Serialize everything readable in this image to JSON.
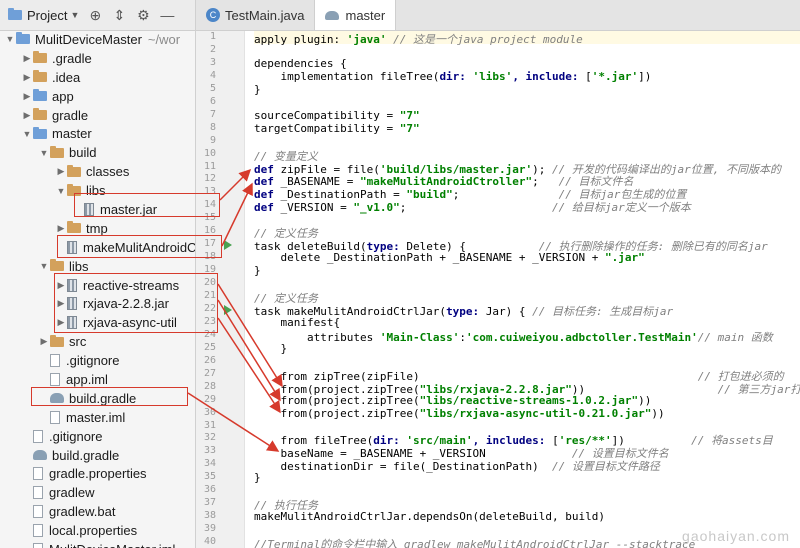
{
  "project_panel": {
    "selector_label": "Project",
    "tree": [
      {
        "indent": 0,
        "arrow": "down",
        "icon": "folder-blue",
        "label": "MulitDeviceMaster",
        "suffix": "~/wor"
      },
      {
        "indent": 1,
        "arrow": "right",
        "icon": "folder",
        "label": ".gradle"
      },
      {
        "indent": 1,
        "arrow": "right",
        "icon": "folder",
        "label": ".idea"
      },
      {
        "indent": 1,
        "arrow": "right",
        "icon": "folder-blue",
        "label": "app"
      },
      {
        "indent": 1,
        "arrow": "right",
        "icon": "folder",
        "label": "gradle"
      },
      {
        "indent": 1,
        "arrow": "down",
        "icon": "folder-blue",
        "label": "master"
      },
      {
        "indent": 2,
        "arrow": "down",
        "icon": "folder",
        "label": "build"
      },
      {
        "indent": 3,
        "arrow": "right",
        "icon": "folder",
        "label": "classes"
      },
      {
        "indent": 3,
        "arrow": "down",
        "icon": "folder",
        "label": "libs"
      },
      {
        "indent": 4,
        "arrow": "",
        "icon": "jar",
        "label": "master.jar"
      },
      {
        "indent": 3,
        "arrow": "right",
        "icon": "folder",
        "label": "tmp"
      },
      {
        "indent": 3,
        "arrow": "",
        "icon": "jar",
        "label": "makeMulitAndroidCtrller"
      },
      {
        "indent": 2,
        "arrow": "down",
        "icon": "folder",
        "label": "libs"
      },
      {
        "indent": 3,
        "arrow": "right",
        "icon": "jar",
        "label": "reactive-streams"
      },
      {
        "indent": 3,
        "arrow": "right",
        "icon": "jar",
        "label": "rxjava-2.2.8.jar"
      },
      {
        "indent": 3,
        "arrow": "right",
        "icon": "jar",
        "label": "rxjava-async-util"
      },
      {
        "indent": 2,
        "arrow": "right",
        "icon": "folder",
        "label": "src"
      },
      {
        "indent": 2,
        "arrow": "",
        "icon": "file",
        "label": ".gitignore"
      },
      {
        "indent": 2,
        "arrow": "",
        "icon": "file",
        "label": "app.iml"
      },
      {
        "indent": 2,
        "arrow": "",
        "icon": "gradle",
        "label": "build.gradle"
      },
      {
        "indent": 2,
        "arrow": "",
        "icon": "file",
        "label": "master.iml"
      },
      {
        "indent": 1,
        "arrow": "",
        "icon": "file",
        "label": ".gitignore"
      },
      {
        "indent": 1,
        "arrow": "",
        "icon": "gradle",
        "label": "build.gradle"
      },
      {
        "indent": 1,
        "arrow": "",
        "icon": "file",
        "label": "gradle.properties"
      },
      {
        "indent": 1,
        "arrow": "",
        "icon": "file",
        "label": "gradlew"
      },
      {
        "indent": 1,
        "arrow": "",
        "icon": "file",
        "label": "gradlew.bat"
      },
      {
        "indent": 1,
        "arrow": "",
        "icon": "file",
        "label": "local.properties"
      },
      {
        "indent": 1,
        "arrow": "",
        "icon": "file",
        "label": "MulitDeviceMaster.iml"
      }
    ]
  },
  "tabs": [
    {
      "label": "TestMain.java",
      "icon": "java-class-icon",
      "active": false
    },
    {
      "label": "master",
      "icon": "gradle-icon",
      "active": true
    }
  ],
  "editor": {
    "run_marker_lines": [
      17,
      22
    ],
    "current_line": 1,
    "lines": [
      [
        [
          "plain",
          "apply plugin: "
        ],
        [
          "str",
          "'java'"
        ],
        [
          "cmt",
          " // 这是一个java project module"
        ]
      ],
      [],
      [
        [
          "plain",
          "dependencies {"
        ]
      ],
      [
        [
          "plain",
          "    implementation fileTree("
        ],
        [
          "kw",
          "dir: "
        ],
        [
          "str",
          "'libs'"
        ],
        [
          "kw",
          ", include: "
        ],
        [
          "plain",
          "["
        ],
        [
          "str",
          "'*.jar'"
        ],
        [
          "plain",
          "])"
        ]
      ],
      [
        [
          "plain",
          "}"
        ]
      ],
      [],
      [
        [
          "plain",
          "sourceCompatibility = "
        ],
        [
          "str",
          "\"7\""
        ]
      ],
      [
        [
          "plain",
          "targetCompatibility = "
        ],
        [
          "str",
          "\"7\""
        ]
      ],
      [],
      [
        [
          "cmt",
          "// 变量定义"
        ]
      ],
      [
        [
          "kw",
          "def "
        ],
        [
          "plain",
          "zipFile = file("
        ],
        [
          "str",
          "'build/libs/master.jar'"
        ],
        [
          "plain",
          ");"
        ],
        [
          "cmt",
          " // 开发的代码编译出的jar位置, 不同版本的"
        ]
      ],
      [
        [
          "kw",
          "def "
        ],
        [
          "plain",
          "_BASENAME = "
        ],
        [
          "str",
          "\"makeMulitAndroidCtroller\""
        ],
        [
          "plain",
          ";"
        ],
        [
          "cmt",
          "   // 目标文件名"
        ]
      ],
      [
        [
          "kw",
          "def "
        ],
        [
          "plain",
          "_DestinationPath = "
        ],
        [
          "str",
          "\"build\""
        ],
        [
          "plain",
          ";"
        ],
        [
          "cmt",
          "               // 目标jar包生成的位置"
        ]
      ],
      [
        [
          "kw",
          "def "
        ],
        [
          "plain",
          "_VERSION = "
        ],
        [
          "str",
          "\"_v1.0\""
        ],
        [
          "plain",
          ";"
        ],
        [
          "cmt",
          "                      // 给目标jar定义一个版本"
        ]
      ],
      [],
      [
        [
          "cmt",
          "// 定义任务"
        ]
      ],
      [
        [
          "plain",
          "task deleteBuild("
        ],
        [
          "kw",
          "type: "
        ],
        [
          "plain",
          "Delete) {"
        ],
        [
          "cmt",
          "           // 执行删除操作的任务: 删除已有的同名jar"
        ]
      ],
      [
        [
          "plain",
          "    delete _DestinationPath + _BASENAME + _VERSION + "
        ],
        [
          "str",
          "\".jar\""
        ]
      ],
      [
        [
          "plain",
          "}"
        ]
      ],
      [],
      [
        [
          "cmt",
          "// 定义任务"
        ]
      ],
      [
        [
          "plain",
          "task makeMulitAndroidCtrlJar("
        ],
        [
          "kw",
          "type: "
        ],
        [
          "plain",
          "Jar) {"
        ],
        [
          "cmt",
          " // 目标任务: 生成目标jar"
        ]
      ],
      [
        [
          "plain",
          "    manifest{"
        ]
      ],
      [
        [
          "plain",
          "        attributes "
        ],
        [
          "str",
          "'Main-Class'"
        ],
        [
          "plain",
          ":"
        ],
        [
          "str",
          "'com.cuiweiyou.adbctoller.TestMain'"
        ],
        [
          "cmt",
          "// main 函数"
        ]
      ],
      [
        [
          "plain",
          "    }"
        ]
      ],
      [],
      [
        [
          "plain",
          "    from zipTree(zipFile)"
        ],
        [
          "cmt",
          "                                          // 打包进必须的"
        ]
      ],
      [
        [
          "plain",
          "    from(project.zipTree("
        ],
        [
          "str",
          "\"libs/rxjava-2.2.8.jar\""
        ],
        [
          "plain",
          "))"
        ],
        [
          "cmt",
          "                    // 第三方jar打"
        ]
      ],
      [
        [
          "plain",
          "    from(project.zipTree("
        ],
        [
          "str",
          "\"libs/reactive-streams-1.0.2.jar\""
        ],
        [
          "plain",
          "))"
        ]
      ],
      [
        [
          "plain",
          "    from(project.zipTree("
        ],
        [
          "str",
          "\"libs/rxjava-async-util-0.21.0.jar\""
        ],
        [
          "plain",
          "))"
        ]
      ],
      [],
      [
        [
          "plain",
          "    from fileTree("
        ],
        [
          "kw",
          "dir: "
        ],
        [
          "str",
          "'src/main'"
        ],
        [
          "kw",
          ", includes: "
        ],
        [
          "plain",
          "["
        ],
        [
          "str",
          "'res/**'"
        ],
        [
          "plain",
          "])"
        ],
        [
          "cmt",
          "          // 将assets目"
        ]
      ],
      [
        [
          "plain",
          "    baseName = _BASENAME + _VERSION"
        ],
        [
          "cmt",
          "             // 设置目标文件名"
        ]
      ],
      [
        [
          "plain",
          "    destinationDir = file(_DestinationPath)"
        ],
        [
          "cmt",
          "  // 设置目标文件路径"
        ]
      ],
      [
        [
          "plain",
          "}"
        ]
      ],
      [],
      [
        [
          "cmt",
          "// 执行任务"
        ]
      ],
      [
        [
          "plain",
          "makeMulitAndroidCtrlJar.dependsOn(deleteBuild, build)"
        ]
      ],
      [],
      [
        [
          "cmt",
          "//Terminal的命令栏中输入 gradlew makeMulitAndroidCtrlJar --stacktrace"
        ]
      ]
    ]
  },
  "watermark": "gaohaiyan.com",
  "colors": {
    "annotation_red": "#d63a2c"
  }
}
